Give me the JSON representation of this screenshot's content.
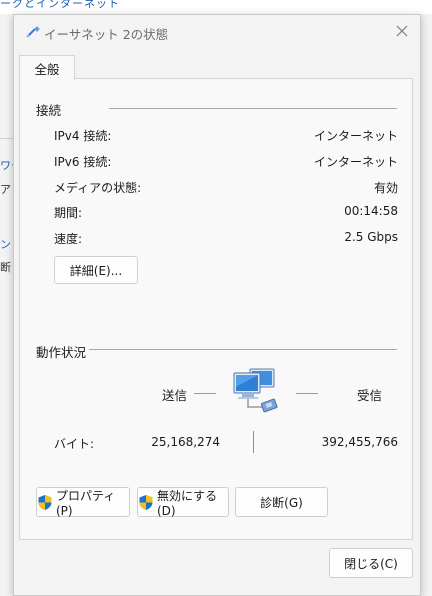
{
  "window": {
    "title": "イーサネット 2の状態"
  },
  "tabs": [
    {
      "label": "全般"
    }
  ],
  "connection": {
    "section_title": "接続",
    "rows": [
      {
        "label": "IPv4 接続:",
        "value": "インターネット"
      },
      {
        "label": "IPv6 接続:",
        "value": "インターネット"
      },
      {
        "label": "メディアの状態:",
        "value": "有効"
      },
      {
        "label": "期間:",
        "value": "00:14:58"
      },
      {
        "label": "速度:",
        "value": "2.5 Gbps"
      }
    ],
    "details_button": "詳細(E)..."
  },
  "activity": {
    "section_title": "動作状況",
    "sent_label": "送信",
    "received_label": "受信",
    "bytes_label": "バイト:",
    "bytes_sent": "25,168,274",
    "bytes_received": "392,455,766"
  },
  "buttons": {
    "properties": "プロパティ(P)",
    "disable": "無効にする(D)",
    "diagnose": "診断(G)",
    "close": "閉じる(C)"
  },
  "background_fragments": {
    "top": "ークとインターネット",
    "left_1": "ワー",
    "left_2": "アッ",
    "left_3": "ン",
    "left_4": "断"
  },
  "icons": {
    "title": "network-cable-icon",
    "close": "close-icon",
    "shield": "uac-shield-icon",
    "network": "network-computers-icon"
  }
}
